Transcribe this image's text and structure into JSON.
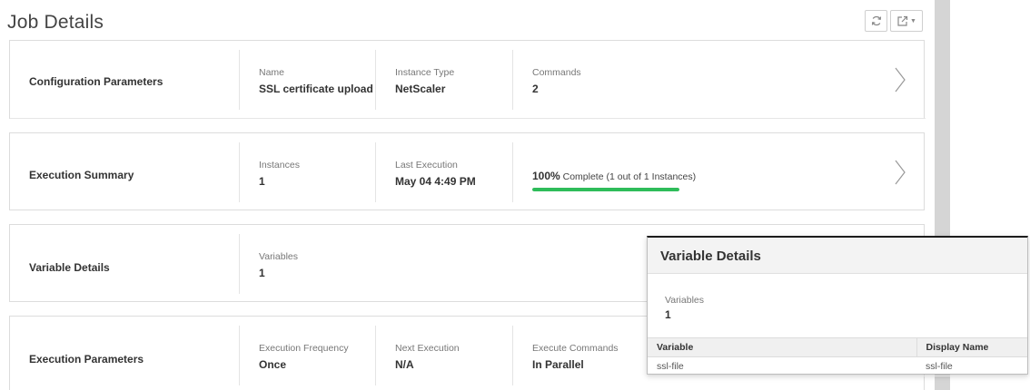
{
  "page": {
    "title": "Job Details"
  },
  "toolbar": {
    "refresh_icon": "refresh-icon",
    "open_external_icon": "open-external-icon"
  },
  "cards": {
    "configuration": {
      "title": "Configuration Parameters",
      "name_label": "Name",
      "name_value": "SSL certificate upload",
      "instance_type_label": "Instance Type",
      "instance_type_value": "NetScaler",
      "commands_label": "Commands",
      "commands_value": "2"
    },
    "execution_summary": {
      "title": "Execution Summary",
      "instances_label": "Instances",
      "instances_value": "1",
      "last_execution_label": "Last Execution",
      "last_execution_value": "May 04 4:49 PM",
      "progress_percent": "100%",
      "progress_text": "Complete (1 out of 1 Instances)",
      "progress_fraction": 1.0,
      "progress_color": "#2ebc5a"
    },
    "variable_details": {
      "title": "Variable Details",
      "variables_label": "Variables",
      "variables_value": "1"
    },
    "execution_parameters": {
      "title": "Execution Parameters",
      "frequency_label": "Execution Frequency",
      "frequency_value": "Once",
      "next_execution_label": "Next Execution",
      "next_execution_value": "N/A",
      "execute_commands_label": "Execute Commands",
      "execute_commands_value": "In Parallel"
    }
  },
  "popup": {
    "title": "Variable Details",
    "variables_label": "Variables",
    "variables_value": "1",
    "table": {
      "headers": [
        "Variable",
        "Display Name"
      ],
      "rows": [
        [
          "ssl-file",
          "ssl-file"
        ]
      ]
    }
  }
}
